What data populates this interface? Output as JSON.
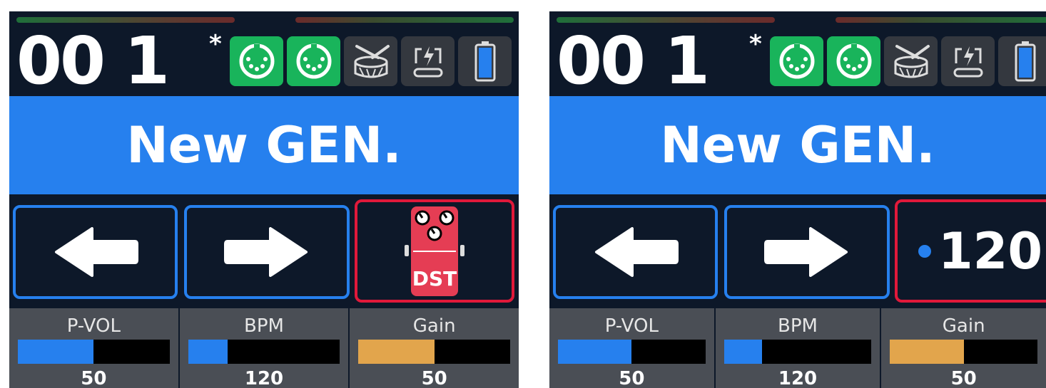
{
  "colors": {
    "background": "#0d1829",
    "accent_blue": "#2680ee",
    "active_green": "#19b45b",
    "inactive_gray": "#34383f",
    "highlight_red": "#e0193a",
    "gain_orange": "#e2a54c"
  },
  "screens": [
    {
      "preset_number": "00 1",
      "modified_marker": "*",
      "status_icons": [
        {
          "icon": "midi-in-icon",
          "active": true
        },
        {
          "icon": "midi-out-icon",
          "active": true
        },
        {
          "icon": "drum-icon",
          "active": false
        },
        {
          "icon": "usb-power-icon",
          "active": false
        },
        {
          "icon": "battery-icon",
          "active": false
        }
      ],
      "preset_name": "New GEN.",
      "buttons": [
        {
          "icon": "arrow-left-icon"
        },
        {
          "icon": "arrow-right-icon"
        },
        {
          "icon": "distortion-pedal-icon",
          "pedal_label": "DST"
        }
      ],
      "params": [
        {
          "label": "P-VOL",
          "value": "50",
          "level": 0.5,
          "color": "#2680ee"
        },
        {
          "label": "BPM",
          "value": "120",
          "level": 0.26,
          "color": "#2680ee"
        },
        {
          "label": "Gain",
          "value": "50",
          "level": 0.5,
          "color": "#e2a54c"
        }
      ]
    },
    {
      "preset_number": "00 1",
      "modified_marker": "*",
      "status_icons": [
        {
          "icon": "midi-in-icon",
          "active": true
        },
        {
          "icon": "midi-out-icon",
          "active": true
        },
        {
          "icon": "drum-icon",
          "active": false
        },
        {
          "icon": "usb-power-icon",
          "active": false
        },
        {
          "icon": "battery-icon",
          "active": false
        }
      ],
      "preset_name": "New GEN.",
      "buttons": [
        {
          "icon": "arrow-left-icon"
        },
        {
          "icon": "arrow-right-icon"
        },
        {
          "icon": "tempo-dot-icon",
          "bpm_value": "120"
        }
      ],
      "params": [
        {
          "label": "P-VOL",
          "value": "50",
          "level": 0.5,
          "color": "#2680ee"
        },
        {
          "label": "BPM",
          "value": "120",
          "level": 0.26,
          "color": "#2680ee"
        },
        {
          "label": "Gain",
          "value": "50",
          "level": 0.5,
          "color": "#e2a54c"
        }
      ]
    }
  ]
}
